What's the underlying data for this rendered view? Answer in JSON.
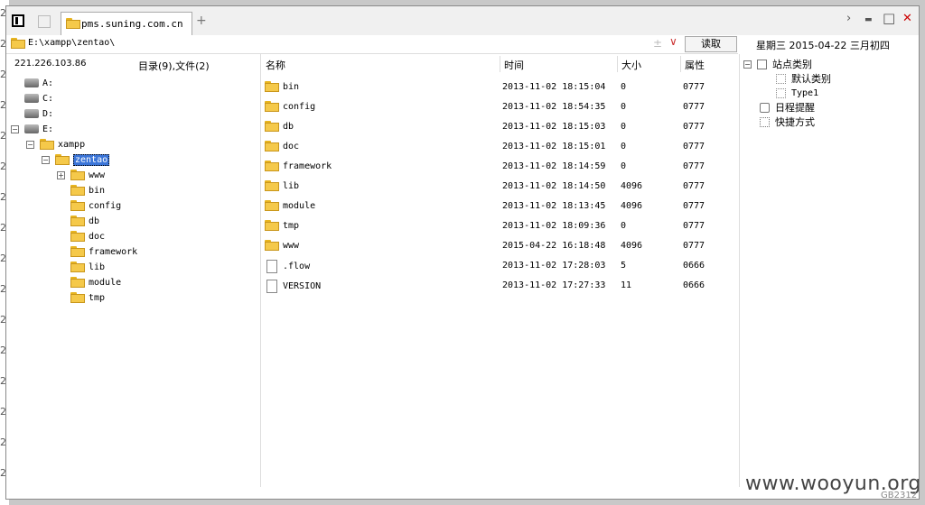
{
  "window": {
    "tab_title": "pms.suning.com.cn",
    "new_tab": "+",
    "controls": {
      "next": "›",
      "minimize": "▬",
      "maximize": "□",
      "close": "✕"
    }
  },
  "address": {
    "value": "E:\\xampp\\zentao\\",
    "plusminus": "±",
    "dropdown": "∨"
  },
  "read_button": "读取",
  "date_text": "星期三 2015-04-22 三月初四",
  "left_header": {
    "ip": "221.226.103.86",
    "count": "目录(9),文件(2)"
  },
  "tree": [
    {
      "label": "A:",
      "icon": "drive-icon",
      "level": 0,
      "toggle": ""
    },
    {
      "label": "C:",
      "icon": "drive-icon",
      "level": 0,
      "toggle": ""
    },
    {
      "label": "D:",
      "icon": "drive-icon",
      "level": 0,
      "toggle": ""
    },
    {
      "label": "E:",
      "icon": "drive-icon",
      "level": 0,
      "toggle": "−"
    },
    {
      "label": "xampp",
      "icon": "folder-icon",
      "level": 1,
      "toggle": "−"
    },
    {
      "label": "zentao",
      "icon": "folder-open-icon",
      "level": 2,
      "toggle": "−",
      "selected": true
    },
    {
      "label": "www",
      "icon": "folder-icon",
      "level": 3,
      "toggle": "+"
    },
    {
      "label": "bin",
      "icon": "folder-icon",
      "level": 3,
      "toggle": ""
    },
    {
      "label": "config",
      "icon": "folder-icon",
      "level": 3,
      "toggle": ""
    },
    {
      "label": "db",
      "icon": "folder-icon",
      "level": 3,
      "toggle": ""
    },
    {
      "label": "doc",
      "icon": "folder-icon",
      "level": 3,
      "toggle": ""
    },
    {
      "label": "framework",
      "icon": "folder-icon",
      "level": 3,
      "toggle": ""
    },
    {
      "label": "lib",
      "icon": "folder-icon",
      "level": 3,
      "toggle": ""
    },
    {
      "label": "module",
      "icon": "folder-icon",
      "level": 3,
      "toggle": ""
    },
    {
      "label": "tmp",
      "icon": "folder-icon",
      "level": 3,
      "toggle": ""
    }
  ],
  "columns": {
    "name": "名称",
    "time": "时间",
    "size": "大小",
    "attr": "属性"
  },
  "files": [
    {
      "name": "bin",
      "time": "2013-11-02 18:15:04",
      "size": "0",
      "attr": "0777",
      "icon": "folder-icon"
    },
    {
      "name": "config",
      "time": "2013-11-02 18:54:35",
      "size": "0",
      "attr": "0777",
      "icon": "folder-icon"
    },
    {
      "name": "db",
      "time": "2013-11-02 18:15:03",
      "size": "0",
      "attr": "0777",
      "icon": "folder-icon"
    },
    {
      "name": "doc",
      "time": "2013-11-02 18:15:01",
      "size": "0",
      "attr": "0777",
      "icon": "folder-icon"
    },
    {
      "name": "framework",
      "time": "2013-11-02 18:14:59",
      "size": "0",
      "attr": "0777",
      "icon": "folder-icon"
    },
    {
      "name": "lib",
      "time": "2013-11-02 18:14:50",
      "size": "4096",
      "attr": "0777",
      "icon": "folder-icon"
    },
    {
      "name": "module",
      "time": "2013-11-02 18:13:45",
      "size": "4096",
      "attr": "0777",
      "icon": "folder-icon"
    },
    {
      "name": "tmp",
      "time": "2013-11-02 18:09:36",
      "size": "0",
      "attr": "0777",
      "icon": "folder-icon"
    },
    {
      "name": "www",
      "time": "2015-04-22 16:18:48",
      "size": "4096",
      "attr": "0777",
      "icon": "folder-icon"
    },
    {
      "name": ".flow",
      "time": "2013-11-02 17:28:03",
      "size": "5",
      "attr": "0666",
      "icon": "file-icon"
    },
    {
      "name": "VERSION",
      "time": "2013-11-02 17:27:33",
      "size": "11",
      "attr": "0666",
      "icon": "file-icon"
    }
  ],
  "right_tree": {
    "root": {
      "label": "站点类别",
      "toggle": "−"
    },
    "children": [
      "默认类别",
      "Type1"
    ],
    "others": [
      {
        "label": "日程提醒",
        "icon": "calendar-icon"
      },
      {
        "label": "快捷方式",
        "icon": "shortcut-icon"
      }
    ]
  },
  "watermark": "www.wooyun.org",
  "corner_text": "GB2312",
  "bg_digits": [
    "2",
    "2",
    "2",
    "2",
    "2",
    "2",
    "2",
    "2",
    "2",
    "2",
    "2",
    "2",
    "2",
    "2",
    "2",
    "2"
  ]
}
